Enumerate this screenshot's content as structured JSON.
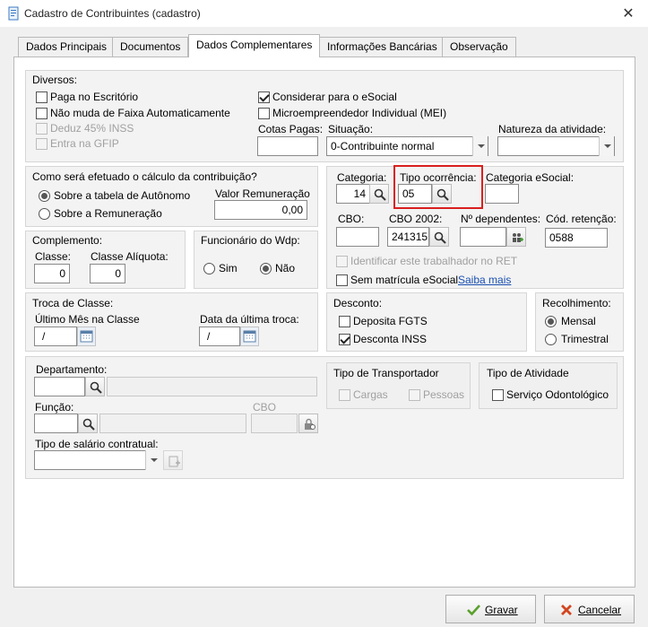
{
  "window": {
    "title": "Cadastro de Contribuintes (cadastro)",
    "close": "✕"
  },
  "tabs": [
    "Dados Principais",
    "Documentos",
    "Dados Complementares",
    "Informações Bancárias",
    "Observação"
  ],
  "diversos": {
    "title": "Diversos:",
    "paga_escritorio": "Paga no Escritório",
    "nao_muda_faixa": "Não muda de Faixa Automaticamente",
    "deduz_inss": "Deduz 45% INSS",
    "entra_gfip": "Entra na GFIP",
    "considerar_esocial": "Considerar para o eSocial",
    "mei": "Microempreendedor Individual (MEI)",
    "cotas_label": "Cotas Pagas:",
    "cotas_value": "",
    "situacao_label": "Situação:",
    "situacao_value": "0-Contribuinte normal",
    "natureza_label": "Natureza da atividade:",
    "natureza_value": ""
  },
  "calculo": {
    "title": "Como será efetuado o cálculo da contribuição?",
    "opt_autonomo": "Sobre a tabela de Autônomo",
    "opt_remuneracao": "Sobre a Remuneração",
    "valor_label": "Valor Remuneração",
    "valor_value": "0,00"
  },
  "categoria": {
    "categoria_label": "Categoria:",
    "categoria_value": "14",
    "tipo_ocorrencia_label": "Tipo ocorrência:",
    "tipo_ocorrencia_value": "05",
    "cat_esocial_label": "Categoria eSocial:",
    "cat_esocial_value": "",
    "cbo_label": "CBO:",
    "cbo_value": "",
    "cbo2002_label": "CBO 2002:",
    "cbo2002_value": "241315",
    "dependentes_label": "Nº dependentes:",
    "dependentes_value": "",
    "retencao_label": "Cód. retenção:",
    "retencao_value": "0588",
    "identificar_label": "Identificar este trabalhador no RET",
    "sem_matricula_label": "Sem matrícula eSocial",
    "saiba_mais": "Saiba mais"
  },
  "complemento": {
    "title": "Complemento:",
    "classe_label": "Classe:",
    "classe_value": "0",
    "aliquota_label": "Classe Alíquota:",
    "aliquota_value": "0"
  },
  "funcionario": {
    "title": "Funcionário do Wdp:",
    "sim": "Sim",
    "nao": "Não"
  },
  "troca": {
    "title": "Troca de Classe:",
    "ultimo_mes_label": "Último Mês na Classe",
    "ultimo_mes_value": "/",
    "data_troca_label": "Data da última troca:",
    "data_troca_value": "/"
  },
  "desconto": {
    "title": "Desconto:",
    "deposita_fgts": "Deposita FGTS",
    "desconta_inss": "Desconta INSS"
  },
  "recolhimento": {
    "title": "Recolhimento:",
    "mensal": "Mensal",
    "trimestral": "Trimestral"
  },
  "lower": {
    "departamento_label": "Departamento:",
    "funcao_label": "Função:",
    "cbo_label": "CBO",
    "tipo_salario_label": "Tipo de salário contratual:"
  },
  "transportador": {
    "title": "Tipo de Transportador",
    "cargas": "Cargas",
    "pessoas": "Pessoas"
  },
  "atividade": {
    "title": "Tipo de Atividade",
    "odontologico": "Serviço Odontológico"
  },
  "buttons": {
    "gravar": "Gravar",
    "cancelar": "Cancelar"
  }
}
